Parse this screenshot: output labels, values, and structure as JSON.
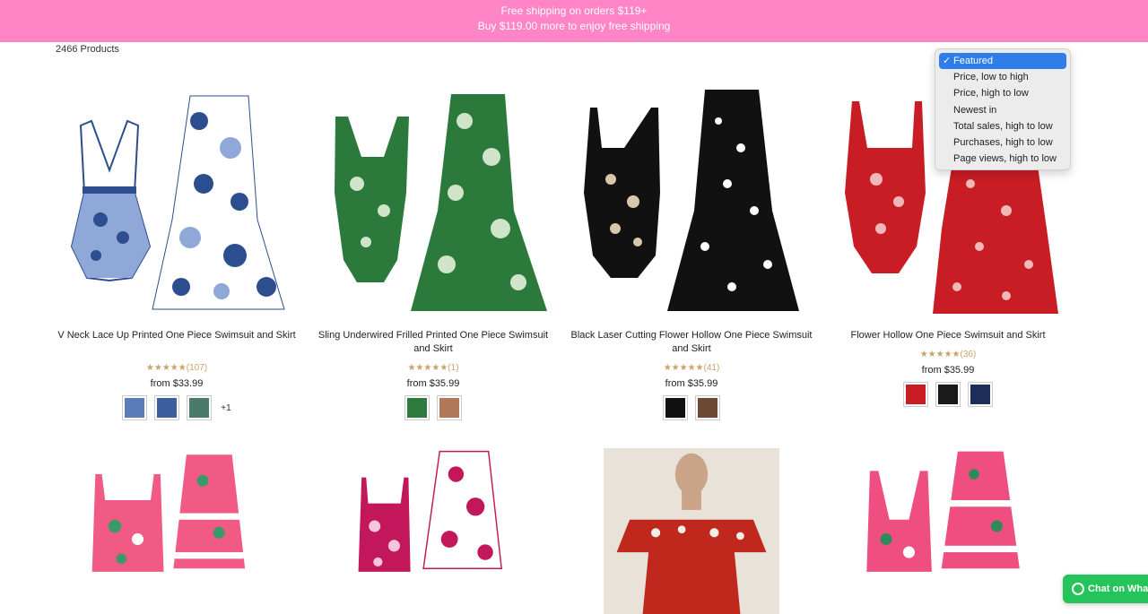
{
  "banner": {
    "line1": "Free shipping on orders $119+",
    "line2": "Buy $119.00 more to enjoy free shipping"
  },
  "product_count": "2466 Products",
  "sort_menu": {
    "options": [
      "Featured",
      "Price, low to high",
      "Price, high to low",
      "Newest in",
      "Total sales, high to low",
      "Purchases, high to low",
      "Page views, high to low"
    ],
    "selected_index": 0,
    "check_glyph": "✓",
    "highlight_color": "#2f7de8"
  },
  "products": [
    {
      "title": "V Neck Lace Up Printed One Piece Swimsuit and Skirt",
      "stars": "★★★★★",
      "review_count": "(107)",
      "price": "from $33.99",
      "swatch_colors": [
        "#5a7db8",
        "#3d5f9e",
        "#4b7a6a"
      ],
      "more_swatches": "+1",
      "palette": [
        "#ffffff",
        "#2d4e8e",
        "#8fa8d8"
      ]
    },
    {
      "title": "Sling Underwired Frilled Printed One Piece Swimsuit and Skirt",
      "stars": "★★★★★",
      "review_count": "(1)",
      "price": "from $35.99",
      "swatch_colors": [
        "#2f7a3e",
        "#b07a5a"
      ],
      "more_swatches": "",
      "palette": [
        "#ffffff",
        "#2b7a3c",
        "#cfe4c8"
      ]
    },
    {
      "title": "Black Laser Cutting Flower Hollow One Piece Swimsuit and Skirt",
      "stars": "★★★★★",
      "review_count": "(41)",
      "price": "from $35.99",
      "swatch_colors": [
        "#111111",
        "#6b4a35"
      ],
      "more_swatches": "",
      "palette": [
        "#ffffff",
        "#111111",
        "#d9c7ad"
      ]
    },
    {
      "title": "Flower Hollow One Piece Swimsuit and Skirt",
      "stars": "★★★★★",
      "review_count": "(36)",
      "price": "from $35.99",
      "swatch_colors": [
        "#c81d25",
        "#1a1a1a",
        "#1d2d5a"
      ],
      "more_swatches": "",
      "palette": [
        "#ffffff",
        "#c81d25",
        "#f2b8b8"
      ]
    },
    {
      "palette": [
        "#ffffff",
        "#f05a85",
        "#3a9a6a"
      ]
    },
    {
      "palette": [
        "#ffffff",
        "#c2185b",
        "#f7c6dc"
      ]
    },
    {
      "palette": [
        "#e8e2d8",
        "#c0281e",
        "#f3efe6"
      ]
    },
    {
      "palette": [
        "#ffffff",
        "#ee4e80",
        "#2f8a5a"
      ]
    }
  ],
  "chat_button": {
    "label": "Chat on Wha",
    "color": "#25c45a"
  }
}
